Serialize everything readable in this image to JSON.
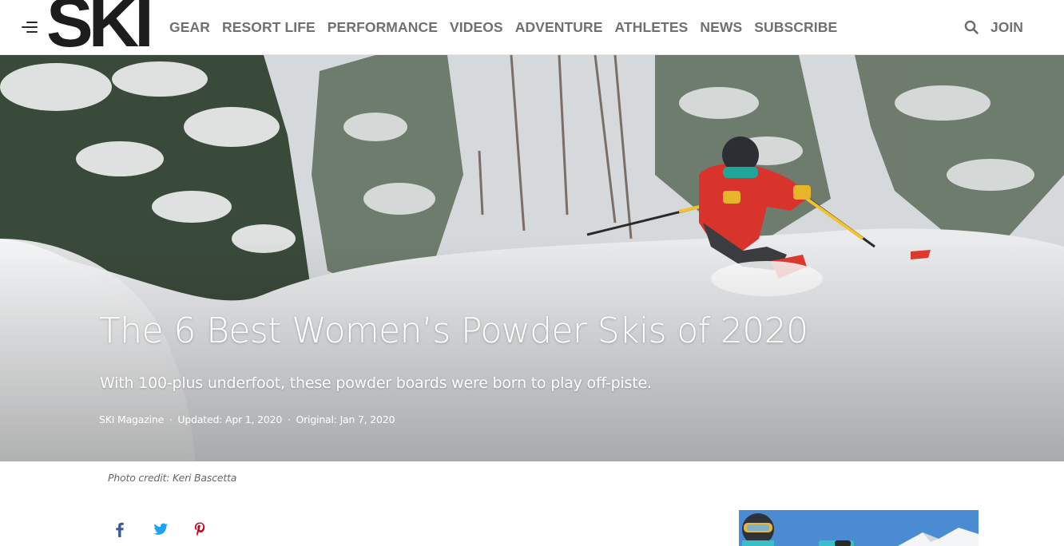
{
  "header": {
    "logo": "SKI",
    "nav": [
      "GEAR",
      "RESORT LIFE",
      "PERFORMANCE",
      "VIDEOS",
      "ADVENTURE",
      "ATHLETES",
      "NEWS",
      "SUBSCRIBE"
    ],
    "join_label": "JOIN",
    "icons": {
      "menu": "hamburger-menu-icon",
      "search": "search-icon"
    }
  },
  "hero": {
    "headline": "The 6 Best Women’s Powder Skis of 2020",
    "dek": "With 100-plus underfoot, these powder boards were born to play off-piste.",
    "byline": {
      "source": "SKI Magazine",
      "updated": "Updated: Apr 1, 2020",
      "original": "Original: Jan 7, 2020",
      "separator": "·"
    }
  },
  "photo_credit": "Photo credit: Keri Bascetta",
  "share": {
    "icons": [
      "facebook-icon",
      "twitter-icon",
      "pinterest-icon"
    ],
    "colors": {
      "facebook": "#3b5998",
      "twitter": "#1da1f2",
      "pinterest": "#bd081c"
    }
  },
  "colors": {
    "nav_text": "#707070",
    "logo": "#1d1d1d",
    "jacket": "#d9342b",
    "poles": "#f2c230"
  }
}
